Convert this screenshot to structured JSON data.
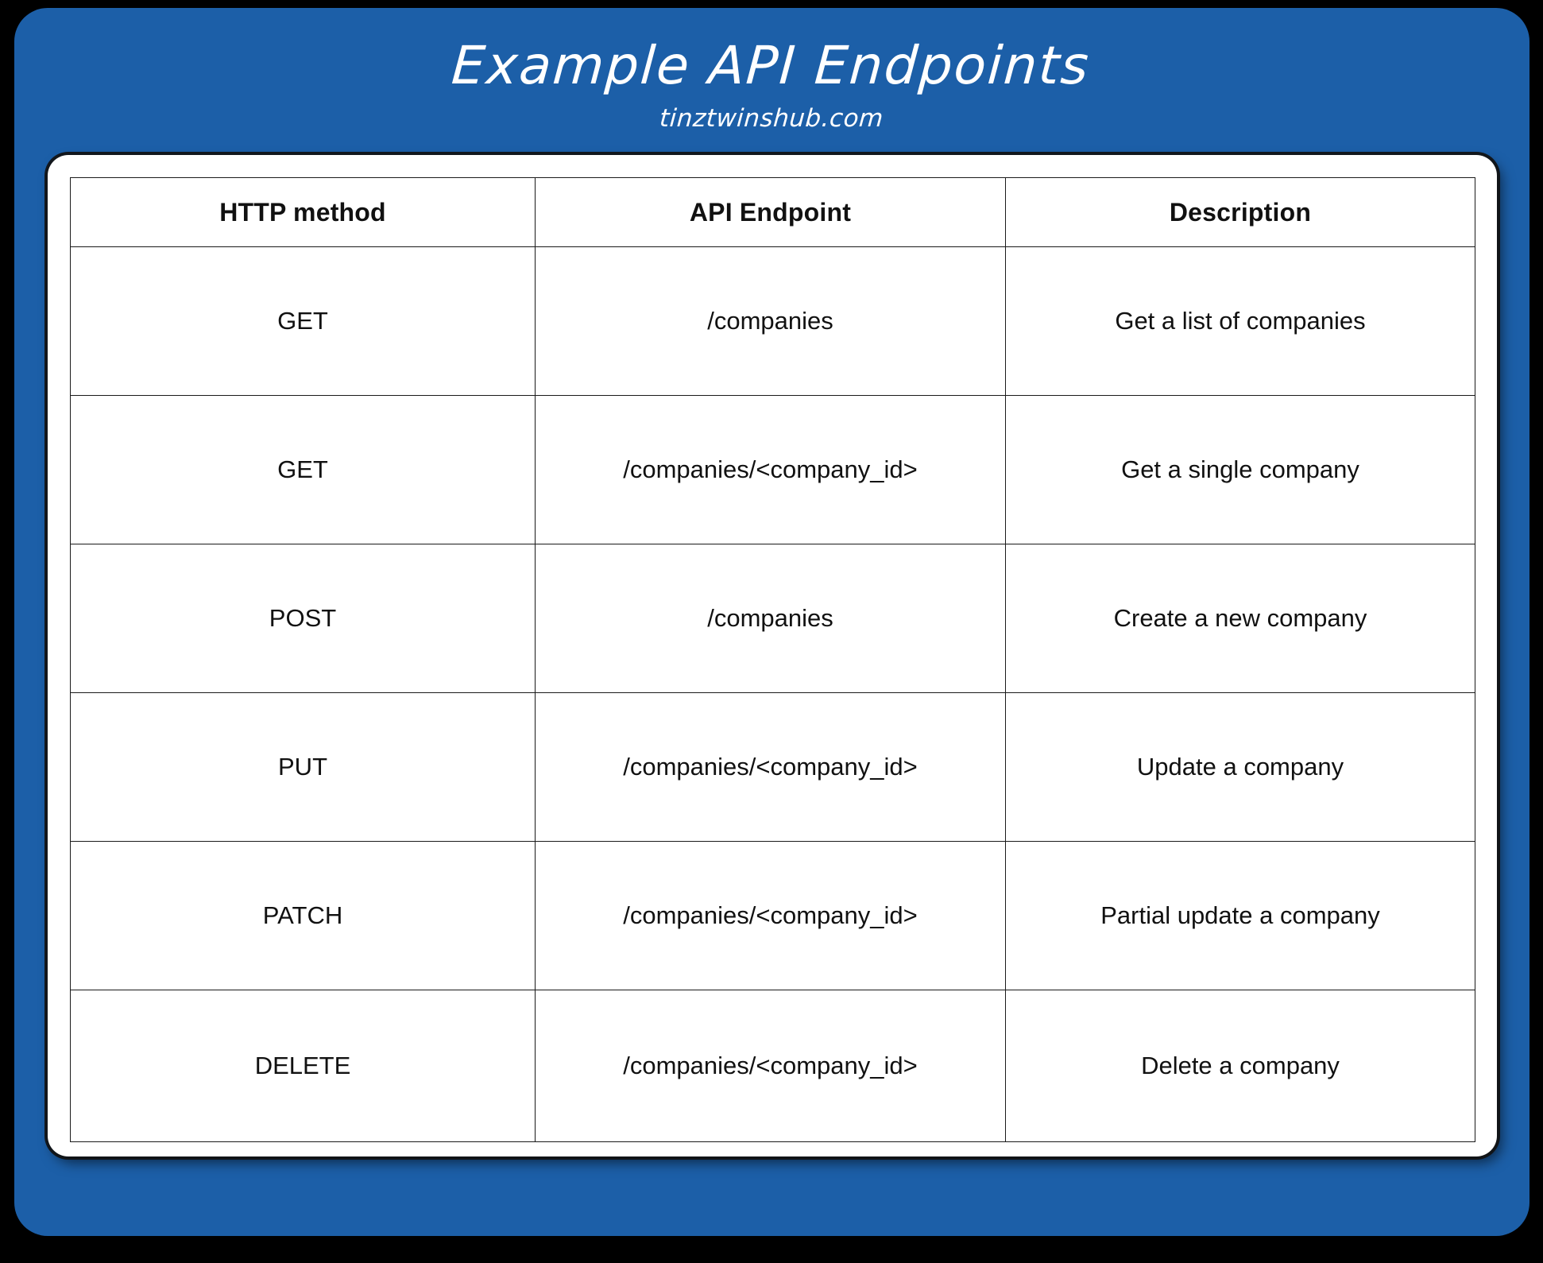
{
  "card": {
    "background_color": "#1c5fa8",
    "panel_color": "#ffffff",
    "page_background": "#000000"
  },
  "header": {
    "title": "Example API Endpoints",
    "subtitle": "tinztwinshub.com"
  },
  "table": {
    "columns": [
      "HTTP method",
      "API Endpoint",
      "Description"
    ],
    "rows": [
      {
        "method": "GET",
        "endpoint": "/companies",
        "description": "Get a list of companies"
      },
      {
        "method": "GET",
        "endpoint": "/companies/<company_id>",
        "description": "Get a single company"
      },
      {
        "method": "POST",
        "endpoint": "/companies",
        "description": "Create a new company"
      },
      {
        "method": "PUT",
        "endpoint": "/companies/<company_id>",
        "description": "Update a company"
      },
      {
        "method": "PATCH",
        "endpoint": "/companies/<company_id>",
        "description": "Partial update a company"
      },
      {
        "method": "DELETE",
        "endpoint": "/companies/<company_id>",
        "description": "Delete a company"
      }
    ]
  }
}
